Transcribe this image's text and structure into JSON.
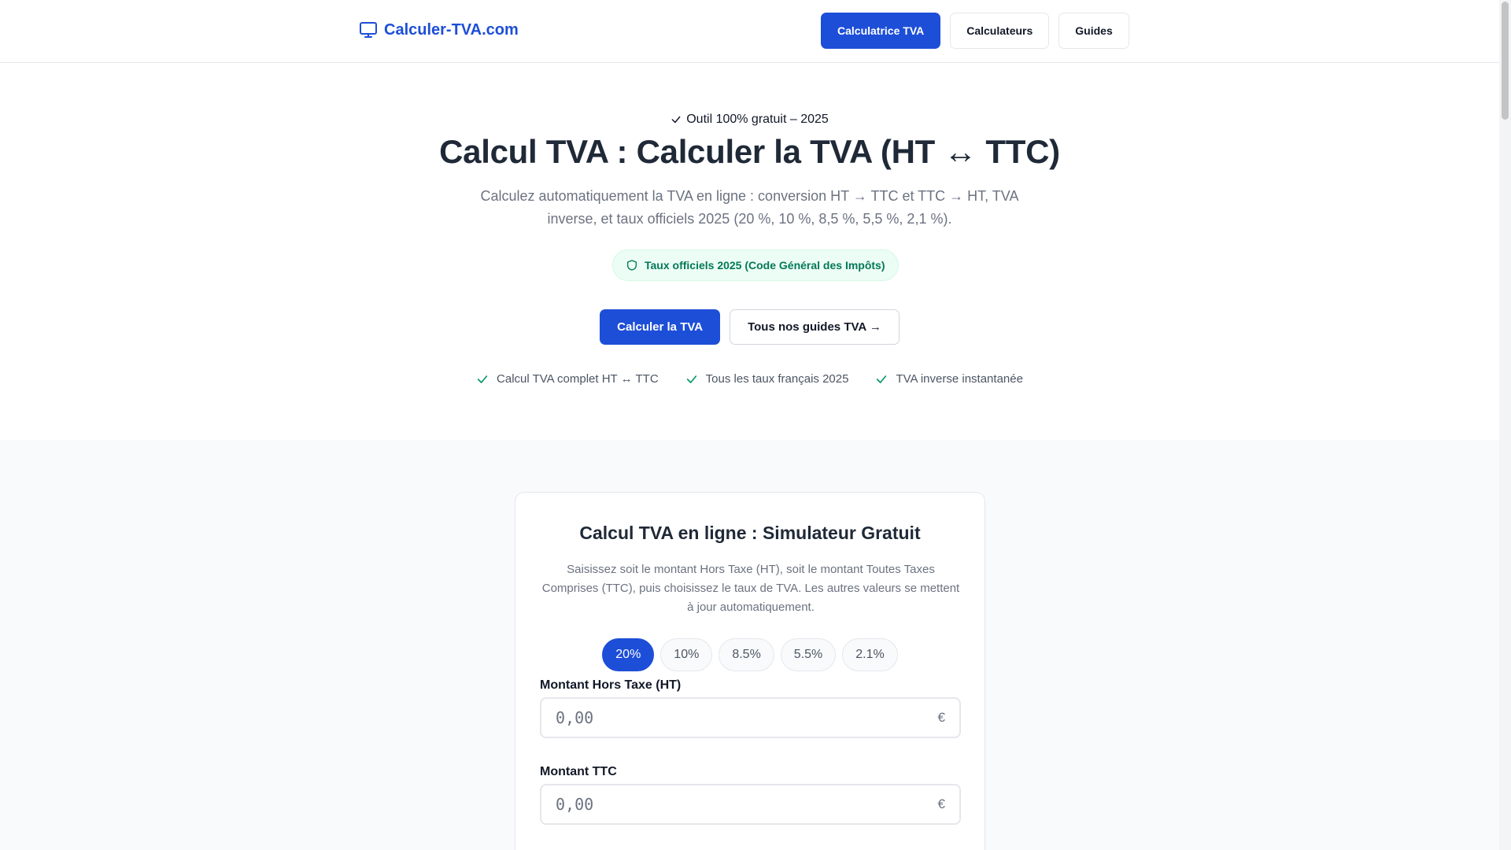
{
  "header": {
    "logo_text": "Calculer-TVA.com",
    "logo_icon": "monitor-icon",
    "nav": [
      {
        "label": "Calculatrice TVA"
      },
      {
        "label": "Calculateurs"
      },
      {
        "label": "Guides"
      }
    ]
  },
  "hero": {
    "eyebrow": "Outil 100% gratuit – 2025",
    "title": "Calcul TVA : Calculer la TVA (HT ↔ TTC)",
    "lead": "Calculez automatiquement la TVA en ligne : conversion HT → TTC et TTC → HT, TVA inverse, et taux officiels 2025 (20 %, 10 %, 8,5 %, 5,5 %, 2,1 %).",
    "badge": "Taux officiels 2025 (Code Général des Impôts)",
    "cta_primary": "Calculer la TVA",
    "cta_secondary": "Tous nos guides TVA →",
    "features": [
      {
        "label": "Calcul TVA complet HT ↔ TTC"
      },
      {
        "label": "Tous les taux français 2025"
      },
      {
        "label": "TVA inverse instantanée"
      }
    ]
  },
  "calculator": {
    "title": "Calcul TVA en ligne : Simulateur Gratuit",
    "description": "Saisissez soit le montant Hors Taxe (HT), soit le montant Toutes Taxes Comprises (TTC), puis choisissez le taux de TVA. Les autres valeurs se mettent à jour automatiquement.",
    "rates": [
      {
        "label": "20%",
        "active": true
      },
      {
        "label": "10%",
        "active": false
      },
      {
        "label": "8.5%",
        "active": false
      },
      {
        "label": "5.5%",
        "active": false
      },
      {
        "label": "2.1%",
        "active": false
      }
    ],
    "ht": {
      "label": "Montant Hors Taxe (HT)",
      "placeholder": "0,00",
      "unit": "€"
    },
    "ttc": {
      "label": "Montant TTC",
      "placeholder": "0,00",
      "unit": "€"
    }
  },
  "colors": {
    "accent": "#1d4ed8",
    "success": "#059669",
    "badge_bg": "#ecfdf5"
  }
}
